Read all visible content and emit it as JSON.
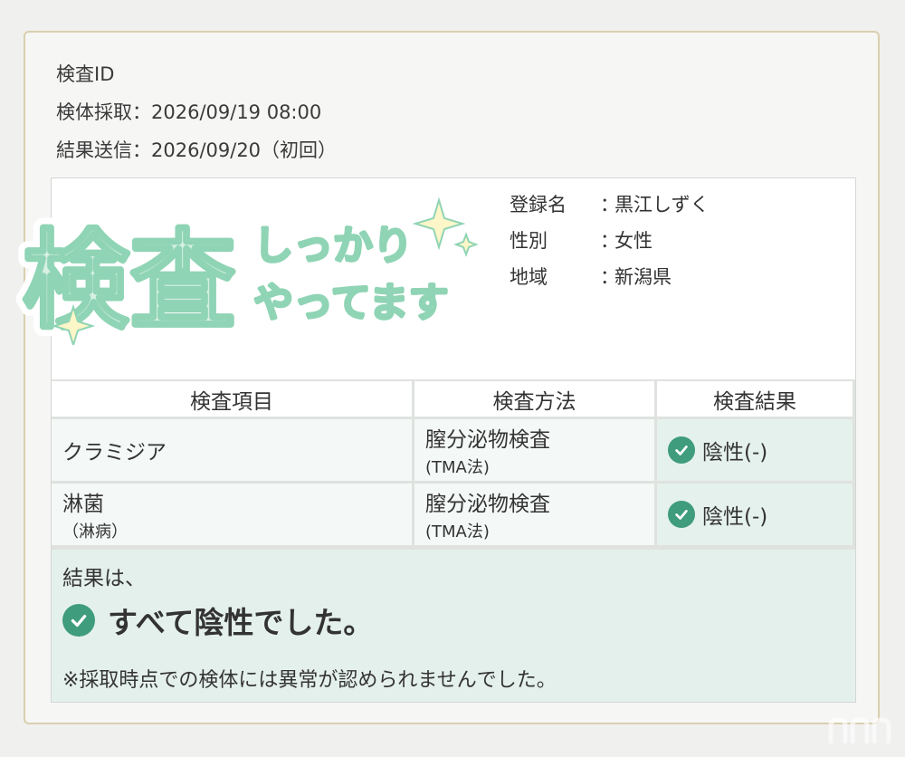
{
  "meta": {
    "id_label": "検査ID",
    "collected": "検体採取：2026/09/19 08:00",
    "sent": "結果送信：2026/09/20（初回）"
  },
  "badge": {
    "main": "検査",
    "line1": "しっかり",
    "line2": "やってます"
  },
  "profile": {
    "rows": [
      {
        "key": "登録名",
        "value": "黒江しずく"
      },
      {
        "key": "性別",
        "value": "女性"
      },
      {
        "key": "地域",
        "value": "新潟県"
      }
    ]
  },
  "table": {
    "headers": [
      "検査項目",
      "検査方法",
      "検査結果"
    ],
    "rows": [
      {
        "item": "クラミジア",
        "item_sub": "",
        "method": "膣分泌物検査",
        "method_sub": "(TMA法)",
        "result": "陰性(-)"
      },
      {
        "item": "淋菌",
        "item_sub": "（淋病）",
        "method": "膣分泌物検査",
        "method_sub": "(TMA法)",
        "result": "陰性(-)"
      }
    ]
  },
  "summary": {
    "intro": "結果は、",
    "main": "すべて陰性でした。",
    "note": "※採取時点での検体には異常が認められませんでした。"
  },
  "watermark": "n​n",
  "icons": {
    "check": "check-circle-icon",
    "sparkle": "sparkle-icon"
  },
  "colors": {
    "accent": "#3f9c7c",
    "border": "#d9cfae",
    "badge": "#8fd4b4"
  }
}
